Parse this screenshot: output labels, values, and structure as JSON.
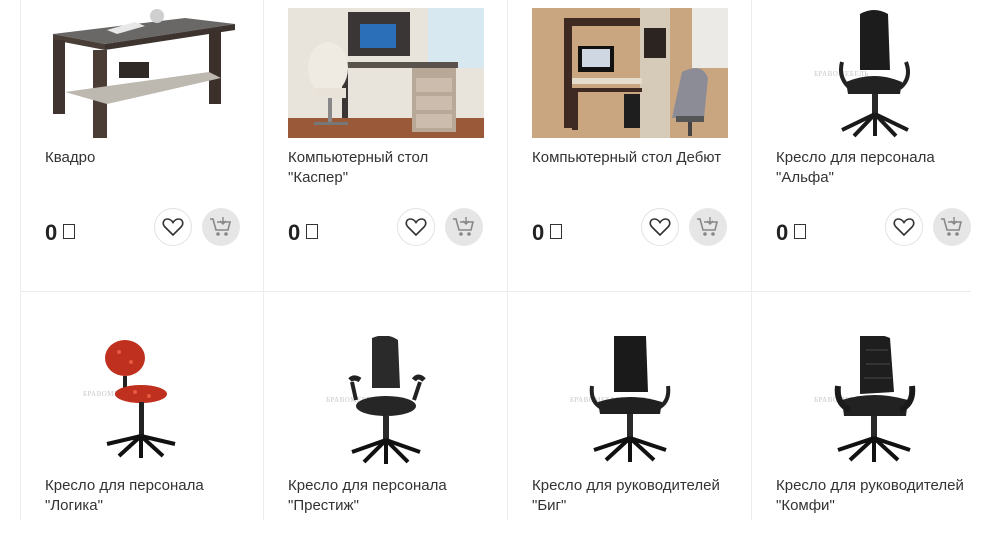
{
  "watermark": "БРАВОМЕБЕЛЬ",
  "currency_icon": "ruble-sign-placeholder",
  "products": [
    {
      "name": "Квадро",
      "price": "0",
      "image": "coffee-table"
    },
    {
      "name": "Компьютерный стол \"Каспер\"",
      "price": "0",
      "image": "computer-desk-room"
    },
    {
      "name": "Компьютерный стол Дебют",
      "price": "0",
      "image": "computer-desk-room"
    },
    {
      "name": "Кресло для персонала \"Альфа\"",
      "price": "0",
      "image": "office-chair"
    },
    {
      "name": "Кресло для персонала \"Логика\"",
      "image": "office-chair"
    },
    {
      "name": "Кресло для персонала \"Престиж\"",
      "image": "office-chair"
    },
    {
      "name": "Кресло для руководителей \"Биг\"",
      "image": "office-chair"
    },
    {
      "name": "Кресло для руководителей \"Комфи\"",
      "image": "office-chair"
    }
  ]
}
